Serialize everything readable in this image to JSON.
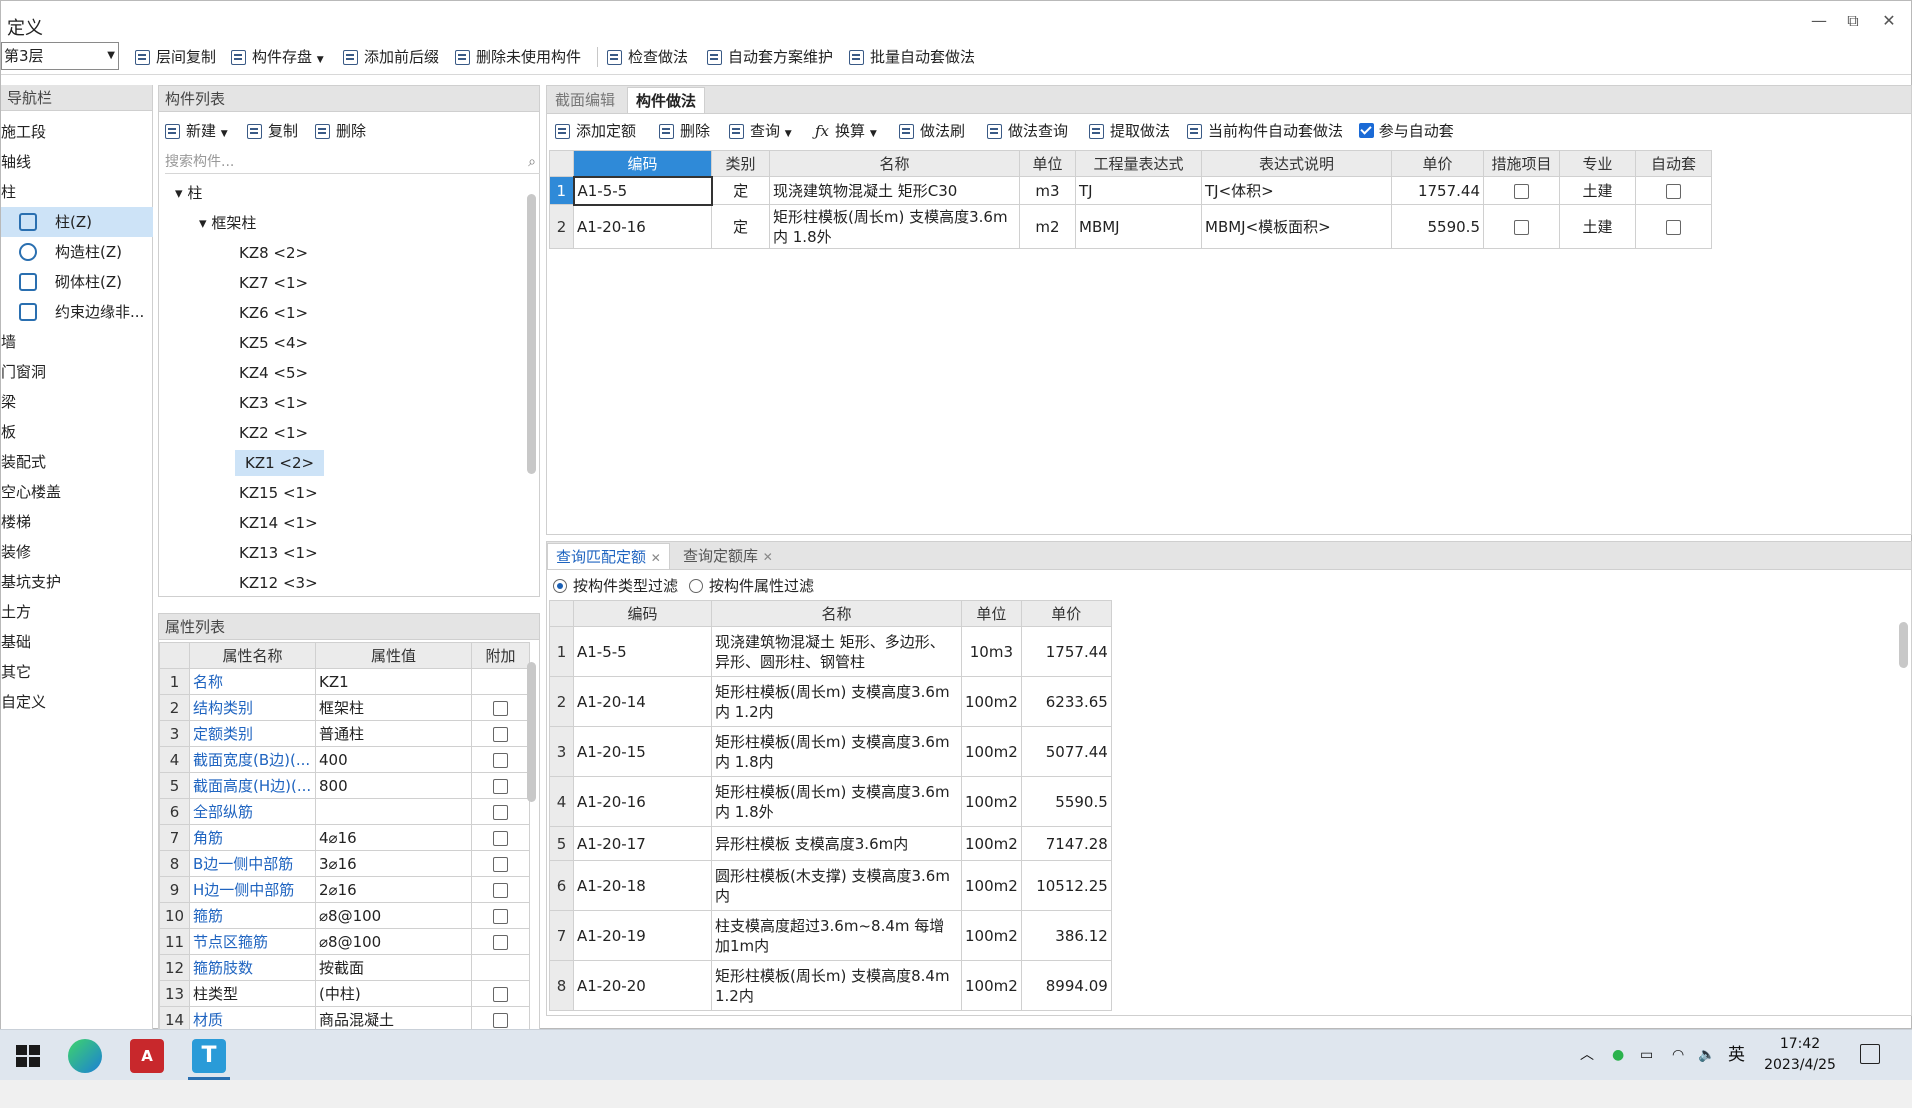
{
  "window": {
    "title": "定义",
    "minimize": "—",
    "restore": "⧉",
    "close": "✕"
  },
  "toolbar": {
    "floor": "第3层",
    "buttons": [
      "层间复制",
      "构件存盘",
      "添加前后缀",
      "删除未使用构件",
      "检查做法",
      "自动套方案维护",
      "批量自动套做法"
    ]
  },
  "nav": {
    "title": "导航栏",
    "items": [
      "施工段",
      "轴线",
      "柱",
      "柱(Z)",
      "构造柱(Z)",
      "砌体柱(Z)",
      "约束边缘非...",
      "墙",
      "门窗洞",
      "梁",
      "板",
      "装配式",
      "空心楼盖",
      "楼梯",
      "装修",
      "基坑支护",
      "土方",
      "基础",
      "其它",
      "自定义"
    ]
  },
  "component_list": {
    "title": "构件列表",
    "new": "新建",
    "copy": "复制",
    "delete": "删除",
    "search_placeholder": "搜索构件...",
    "tree": [
      "柱",
      "框架柱",
      "KZ8 <2>",
      "KZ7 <1>",
      "KZ6 <1>",
      "KZ5 <4>",
      "KZ4 <5>",
      "KZ3 <1>",
      "KZ2 <1>",
      "KZ1 <2>",
      "KZ15 <1>",
      "KZ14 <1>",
      "KZ13 <1>",
      "KZ12 <3>"
    ]
  },
  "property_list": {
    "title": "属性列表",
    "headers": [
      "属性名称",
      "属性值",
      "附加"
    ],
    "rows": [
      {
        "n": "1",
        "name": "名称",
        "value": "KZ1"
      },
      {
        "n": "2",
        "name": "结构类别",
        "value": "框架柱"
      },
      {
        "n": "3",
        "name": "定额类别",
        "value": "普通柱"
      },
      {
        "n": "4",
        "name": "截面宽度(B边)(...",
        "value": "400"
      },
      {
        "n": "5",
        "name": "截面高度(H边)(...",
        "value": "800"
      },
      {
        "n": "6",
        "name": "全部纵筋",
        "value": ""
      },
      {
        "n": "7",
        "name": "角筋",
        "value": "4⌀16"
      },
      {
        "n": "8",
        "name": "B边一侧中部筋",
        "value": "3⌀16"
      },
      {
        "n": "9",
        "name": "H边一侧中部筋",
        "value": "2⌀16"
      },
      {
        "n": "10",
        "name": "箍筋",
        "value": "⌀8@100"
      },
      {
        "n": "11",
        "name": "节点区箍筋",
        "value": "⌀8@100"
      },
      {
        "n": "12",
        "name": "箍筋肢数",
        "value": "按截面"
      },
      {
        "n": "13",
        "name": "柱类型",
        "value": "(中柱)"
      },
      {
        "n": "14",
        "name": "材质",
        "value": "商品混凝土"
      }
    ]
  },
  "tabs_top": [
    "截面编辑",
    "构件做法"
  ],
  "method_toolbar": [
    "添加定额",
    "删除",
    "查询",
    "换算",
    "做法刷",
    "做法查询",
    "提取做法",
    "当前构件自动套做法",
    "参与自动套"
  ],
  "method_table": {
    "headers": [
      "编码",
      "类别",
      "名称",
      "单位",
      "工程量表达式",
      "表达式说明",
      "单价",
      "措施项目",
      "专业",
      "自动套"
    ],
    "rows": [
      {
        "n": "1",
        "code": "A1-5-5",
        "type": "定",
        "name": "现浇建筑物混凝土 矩形C30",
        "unit": "m3",
        "expr": "TJ",
        "desc": "TJ<体积>",
        "price": "1757.44",
        "major": "土建"
      },
      {
        "n": "2",
        "code": "A1-20-16",
        "type": "定",
        "name": "矩形柱模板(周长m) 支模高度3.6m内 1.8外",
        "unit": "m2",
        "expr": "MBMJ",
        "desc": "MBMJ<模板面积>",
        "price": "5590.5",
        "major": "土建"
      }
    ]
  },
  "tabs_bottom": [
    "查询匹配定额",
    "查询定额库"
  ],
  "filters": [
    "按构件类型过滤",
    "按构件属性过滤"
  ],
  "match_table": {
    "headers": [
      "编码",
      "名称",
      "单位",
      "单价"
    ],
    "rows": [
      {
        "n": "1",
        "code": "A1-5-5",
        "name": "现浇建筑物混凝土 矩形、多边形、异形、圆形柱、钢管柱",
        "unit": "10m3",
        "price": "1757.44"
      },
      {
        "n": "2",
        "code": "A1-20-14",
        "name": "矩形柱模板(周长m) 支模高度3.6m内 1.2内",
        "unit": "100m2",
        "price": "6233.65"
      },
      {
        "n": "3",
        "code": "A1-20-15",
        "name": "矩形柱模板(周长m) 支模高度3.6m内 1.8内",
        "unit": "100m2",
        "price": "5077.44"
      },
      {
        "n": "4",
        "code": "A1-20-16",
        "name": "矩形柱模板(周长m) 支模高度3.6m内 1.8外",
        "unit": "100m2",
        "price": "5590.5"
      },
      {
        "n": "5",
        "code": "A1-20-17",
        "name": "异形柱模板 支模高度3.6m内",
        "unit": "100m2",
        "price": "7147.28"
      },
      {
        "n": "6",
        "code": "A1-20-18",
        "name": "圆形柱模板(木支撑) 支模高度3.6m内",
        "unit": "100m2",
        "price": "10512.25"
      },
      {
        "n": "7",
        "code": "A1-20-19",
        "name": "柱支模高度超过3.6m~8.4m 每增加1m内",
        "unit": "100m2",
        "price": "386.12"
      },
      {
        "n": "8",
        "code": "A1-20-20",
        "name": "矩形柱模板(周长m) 支模高度8.4m 1.2内",
        "unit": "100m2",
        "price": "8994.09"
      }
    ]
  },
  "taskbar": {
    "ime": "英",
    "time": "17:42",
    "date": "2023/4/25"
  }
}
